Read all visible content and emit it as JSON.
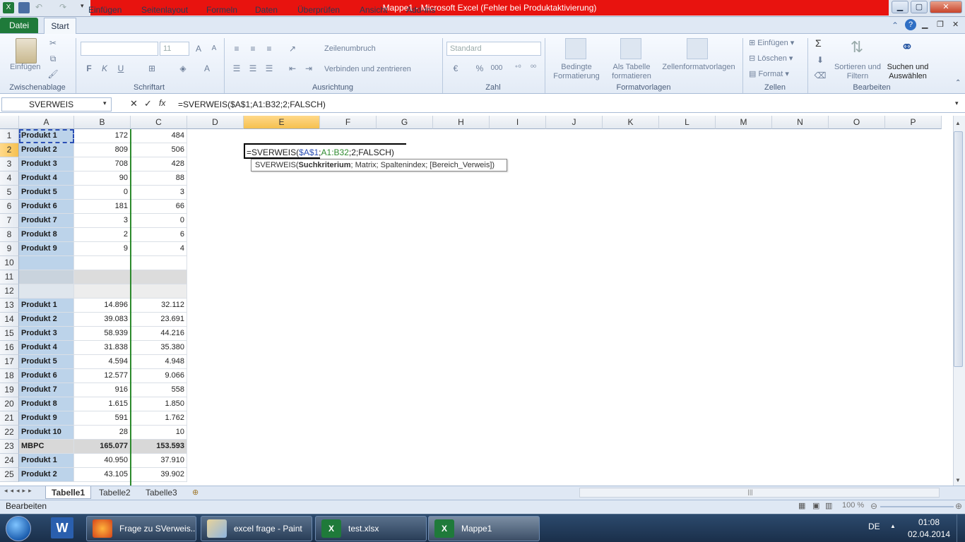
{
  "window": {
    "title": "Mappe1  -  Microsoft Excel (Fehler bei Produktaktivierung)"
  },
  "ribbon_tabs": [
    "Datei",
    "Start",
    "Einfügen",
    "Seitenlayout",
    "Formeln",
    "Daten",
    "Überprüfen",
    "Ansicht",
    "Add-Ins"
  ],
  "ribbon": {
    "paste_label": "Einfügen",
    "group_clipboard": "Zwischenablage",
    "group_font": "Schriftart",
    "font_size": "11",
    "bold": "F",
    "italic": "K",
    "underline": "U",
    "group_alignment": "Ausrichtung",
    "wrap_text": "Zeilenumbruch",
    "merge_center": "Verbinden und zentrieren",
    "group_number": "Zahl",
    "number_format": "Standard",
    "percent": "%",
    "thousands": "000",
    "cond_format": "Bedingte Formatierung",
    "as_table": "Als Tabelle formatieren",
    "cell_styles": "Zellenformatvorlagen",
    "group_styles": "Formatvorlagen",
    "insert": "Einfügen",
    "delete": "Löschen",
    "format": "Format",
    "group_cells": "Zellen",
    "sum": "Σ",
    "sort_filter": "Sortieren und Filtern",
    "find_select": "Suchen und Auswählen",
    "group_editing": "Bearbeiten"
  },
  "formula_bar": {
    "name_box": "SVERWEIS",
    "fx": "fx",
    "formula": "=SVERWEIS($A$1;A1:B32;2;FALSCH)"
  },
  "columns": [
    "A",
    "B",
    "C",
    "D",
    "E",
    "F",
    "G",
    "H",
    "I",
    "J",
    "K",
    "L",
    "M",
    "N",
    "O",
    "P"
  ],
  "rows": [
    {
      "n": "1",
      "a": "Produkt 1",
      "b": "172",
      "c": "484"
    },
    {
      "n": "2",
      "a": "Produkt 2",
      "b": "809",
      "c": "506"
    },
    {
      "n": "3",
      "a": "Produkt 3",
      "b": "708",
      "c": "428"
    },
    {
      "n": "4",
      "a": "Produkt 4",
      "b": "90",
      "c": "88"
    },
    {
      "n": "5",
      "a": "Produkt 5",
      "b": "0",
      "c": "3"
    },
    {
      "n": "6",
      "a": "Produkt 6",
      "b": "181",
      "c": "66"
    },
    {
      "n": "7",
      "a": "Produkt 7",
      "b": "3",
      "c": "0"
    },
    {
      "n": "8",
      "a": "Produkt 8",
      "b": "2",
      "c": "6"
    },
    {
      "n": "9",
      "a": "Produkt 9",
      "b": "9",
      "c": "4"
    },
    {
      "n": "10",
      "a": "",
      "b": "",
      "c": ""
    },
    {
      "n": "11",
      "a": "",
      "b": "",
      "c": ""
    },
    {
      "n": "12",
      "a": "",
      "b": "",
      "c": ""
    },
    {
      "n": "13",
      "a": "Produkt 1",
      "b": "14.896",
      "c": "32.112"
    },
    {
      "n": "14",
      "a": "Produkt 2",
      "b": "39.083",
      "c": "23.691"
    },
    {
      "n": "15",
      "a": "Produkt 3",
      "b": "58.939",
      "c": "44.216"
    },
    {
      "n": "16",
      "a": "Produkt 4",
      "b": "31.838",
      "c": "35.380"
    },
    {
      "n": "17",
      "a": "Produkt 5",
      "b": "4.594",
      "c": "4.948"
    },
    {
      "n": "18",
      "a": "Produkt 6",
      "b": "12.577",
      "c": "9.066"
    },
    {
      "n": "19",
      "a": "Produkt 7",
      "b": "916",
      "c": "558"
    },
    {
      "n": "20",
      "a": "Produkt 8",
      "b": "1.615",
      "c": "1.850"
    },
    {
      "n": "21",
      "a": "Produkt 9",
      "b": "591",
      "c": "1.762"
    },
    {
      "n": "22",
      "a": "Produkt 10",
      "b": "28",
      "c": "10"
    },
    {
      "n": "23",
      "a": "MBPC",
      "b": "165.077",
      "c": "153.593"
    },
    {
      "n": "24",
      "a": "Produkt 1",
      "b": "40.950",
      "c": "37.910"
    },
    {
      "n": "25",
      "a": "Produkt 2",
      "b": "43.105",
      "c": "39.902"
    }
  ],
  "edit_cell": {
    "prefix": "=SVERWEIS(",
    "ref1": "$A$1",
    "sep1": ";",
    "ref2": "A1:B32",
    "rest": ";2;FALSCH)"
  },
  "tooltip": {
    "fn": "SVERWEIS(",
    "arg1": "Suchkriterium",
    "rest": "; Matrix; Spaltenindex; [Bereich_Verweis])"
  },
  "sheets": [
    "Tabelle1",
    "Tabelle2",
    "Tabelle3"
  ],
  "status": {
    "mode": "Bearbeiten",
    "zoom": "100 %"
  },
  "taskbar": {
    "items": [
      "Frage zu SVerweis...",
      "excel frage - Paint",
      "test.xlsx",
      "Mappe1"
    ],
    "lang": "DE",
    "time": "01:08",
    "date": "02.04.2014"
  },
  "colors": {
    "title_red": "#e8130f",
    "datei_green": "#1f7a3a",
    "ref1_blue": "#2b4fb5",
    "ref2_green": "#2d8a2d"
  }
}
